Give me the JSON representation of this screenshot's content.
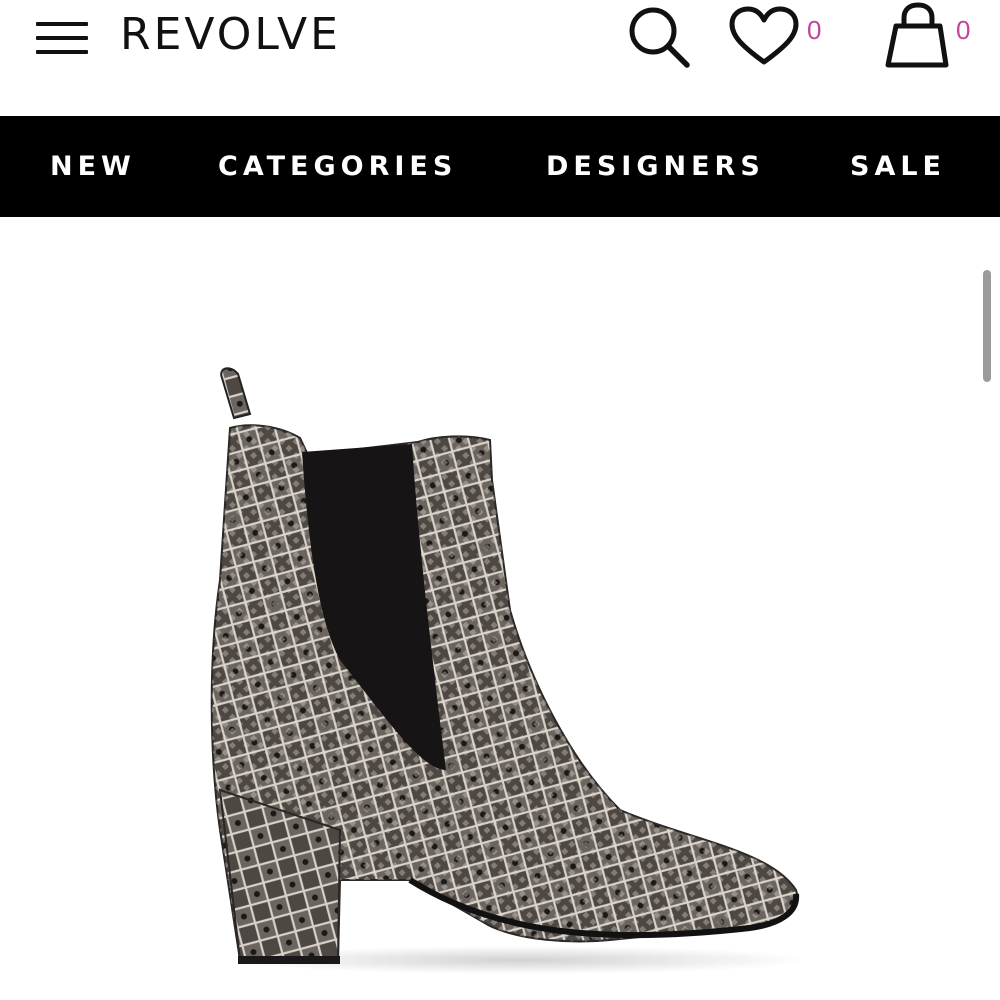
{
  "header": {
    "logo": "REVOLVE",
    "icons": {
      "menu": "hamburger-menu-icon",
      "search": "search-icon",
      "wishlist": "heart-icon",
      "bag": "shopping-bag-icon"
    },
    "wishlist_count": "0",
    "bag_count": "0",
    "badge_color": "#c2459a"
  },
  "nav": {
    "background": "#000000",
    "items": [
      {
        "label": "NEW"
      },
      {
        "label": "CATEGORIES"
      },
      {
        "label": "DESIGNERS"
      },
      {
        "label": "SALE"
      }
    ]
  },
  "product": {
    "image": "snakeskin-chelsea-ankle-boot"
  }
}
